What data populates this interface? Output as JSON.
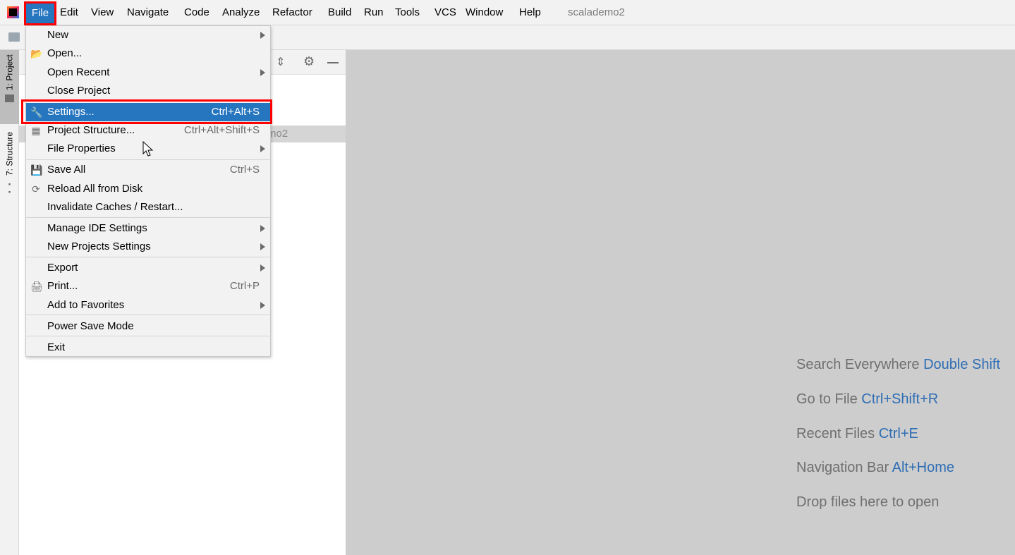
{
  "menubar": {
    "items": [
      "File",
      "Edit",
      "View",
      "Navigate",
      "Code",
      "Analyze",
      "Refactor",
      "Build",
      "Run",
      "Tools",
      "VCS",
      "Window",
      "Help"
    ],
    "project_title": "scalademo2"
  },
  "side_tabs": {
    "project": "1: Project",
    "structure": "7: Structure"
  },
  "panel": {
    "row_text": "mo2"
  },
  "file_menu": {
    "items": [
      {
        "label": "New",
        "submenu": true
      },
      {
        "label": "Open...",
        "icon": "folder-open-icon"
      },
      {
        "label": "Open Recent",
        "submenu": true
      },
      {
        "label": "Close Project"
      },
      {
        "label": "Settings...",
        "shortcut": "Ctrl+Alt+S",
        "icon": "wrench-icon",
        "selected": true
      },
      {
        "label": "Project Structure...",
        "shortcut": "Ctrl+Alt+Shift+S",
        "icon": "project-structure-icon"
      },
      {
        "label": "File Properties",
        "submenu": true
      },
      {
        "label": "Save All",
        "shortcut": "Ctrl+S",
        "icon": "save-icon"
      },
      {
        "label": "Reload All from Disk",
        "icon": "reload-icon"
      },
      {
        "label": "Invalidate Caches / Restart..."
      },
      {
        "label": "Manage IDE Settings",
        "submenu": true
      },
      {
        "label": "New Projects Settings",
        "submenu": true
      },
      {
        "label": "Export",
        "submenu": true
      },
      {
        "label": "Print...",
        "shortcut": "Ctrl+P",
        "icon": "print-icon"
      },
      {
        "label": "Add to Favorites",
        "submenu": true
      },
      {
        "label": "Power Save Mode"
      },
      {
        "label": "Exit"
      }
    ]
  },
  "editor_hints": [
    {
      "text": "Search Everywhere",
      "key": "Double Shift"
    },
    {
      "text": "Go to File",
      "key": "Ctrl+Shift+R"
    },
    {
      "text": "Recent Files",
      "key": "Ctrl+E"
    },
    {
      "text": "Navigation Bar",
      "key": "Alt+Home"
    },
    {
      "text": "Drop files here to open",
      "key": ""
    }
  ],
  "colors": {
    "selection": "#2675bf",
    "highlight_box": "#ff0000",
    "hint_key": "#2e6db4"
  }
}
